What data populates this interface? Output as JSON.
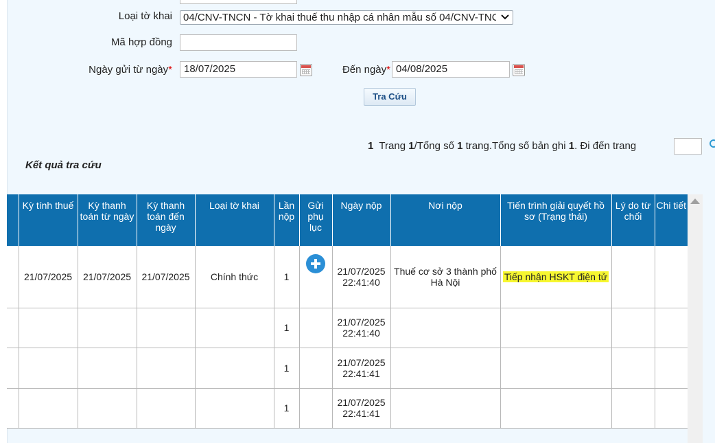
{
  "form": {
    "loai_to_khai_label": "Loại tờ khai",
    "loai_to_khai_value": "04/CNV-TNCN - Tờ khai thuế thu nhập cá nhân mẫu số 04/CNV-TNCN",
    "ma_hop_dong_label": "Mã hợp đồng",
    "ma_hop_dong_value": "",
    "ngay_gui_tu_label": "Ngày gửi từ ngày",
    "ngay_gui_tu_value": "18/07/2025",
    "den_ngay_label": "Đến ngày",
    "den_ngay_value": "04/08/2025",
    "required_mark": "*",
    "search_button": "Tra Cứu"
  },
  "pager": {
    "current": "1",
    "trang": "Trang",
    "current_of": "1",
    "tong_so": "/Tổng số",
    "total_pages": "1",
    "trang_tong_so_ban_ghi": "trang.Tổng số bản ghi",
    "total_records": "1",
    "di_den_trang": ". Đi đến trang",
    "goto_value": ""
  },
  "results_title": "Kết quả tra cứu",
  "table": {
    "headers": [
      "Kỳ tính thuế",
      "Kỳ thanh toán từ ngày",
      "Kỳ thanh toán đến ngày",
      "Loại tờ khai",
      "Lần nộp",
      "Gửi phụ lục",
      "Ngày nộp",
      "Nơi nộp",
      "Tiến trình giải quyết hồ sơ (Trạng thái)",
      "Lý do từ chối",
      "Chi tiết lỗi"
    ],
    "rows": [
      {
        "ky_tinh_thue": "21/07/2025",
        "tu_ngay": "21/07/2025",
        "den_ngay": "21/07/2025",
        "loai": "Chính thức",
        "lan_nop": "1",
        "ngay_nop_date": "21/07/2025",
        "ngay_nop_time": "22:41:40",
        "noi_nop": "Thuế cơ sở 3 thành phố Hà Nội",
        "tien_trinh": "Tiếp nhận HSKT điện tử"
      },
      {
        "lan_nop": "1",
        "ngay_nop_date": "21/07/2025",
        "ngay_nop_time": "22:41:40"
      },
      {
        "lan_nop": "1",
        "ngay_nop_date": "21/07/2025",
        "ngay_nop_time": "22:41:41"
      },
      {
        "lan_nop": "1",
        "ngay_nop_date": "21/07/2025",
        "ngay_nop_time": "22:41:41"
      }
    ]
  },
  "icons": {
    "calendar": "calendar-icon",
    "add": "plus-circle-icon",
    "dropdown": "chevron-down-icon",
    "scroll_up": "scroll-up-arrow-icon",
    "refresh": "refresh-icon"
  },
  "colors": {
    "header_bg": "#0f6fae",
    "page_bg": "#f0f8fe",
    "highlight": "#f7f730",
    "plus_icon": "#2b8fd6",
    "required": "#dd0000"
  }
}
